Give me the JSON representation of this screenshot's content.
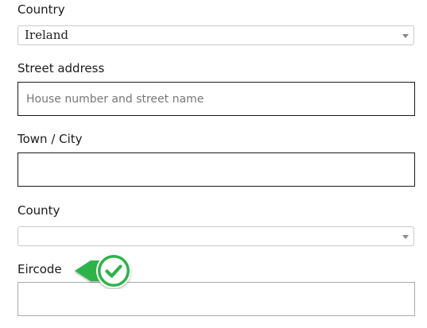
{
  "form": {
    "country_label": "Country",
    "country_value": "Ireland",
    "street_label": "Street address",
    "street_placeholder": "House number and street name",
    "street_value": "",
    "town_label": "Town / City",
    "town_value": "",
    "county_label": "County",
    "county_value": "",
    "eircode_label": "Eircode",
    "eircode_value": ""
  },
  "badge": {
    "icon": "checkmark-icon",
    "color": "#2db34a"
  }
}
